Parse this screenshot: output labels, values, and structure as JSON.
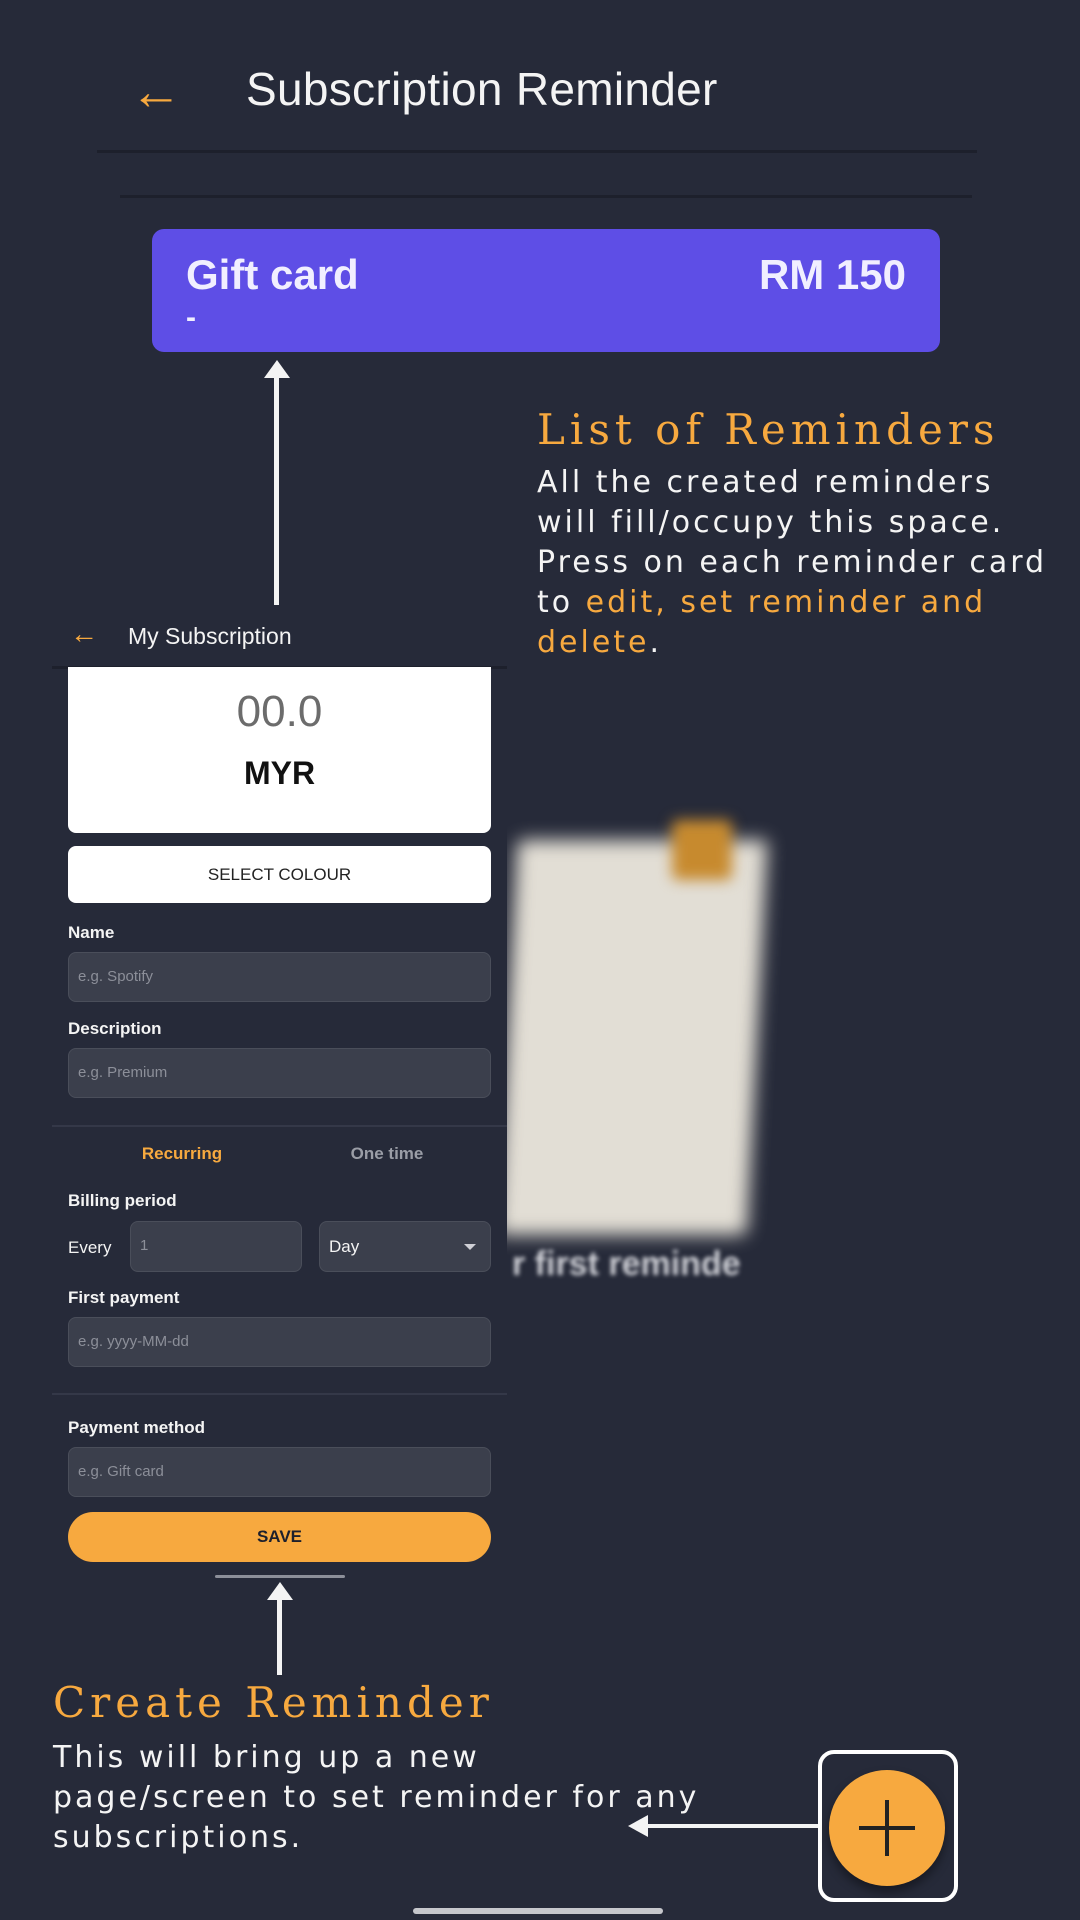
{
  "header": {
    "title": "Subscription Reminder",
    "back_icon": "arrow-back-icon"
  },
  "reminder_card": {
    "name": "Gift card",
    "description": "-",
    "amount": "RM 150",
    "color": "#5e4ee6"
  },
  "annotations": {
    "list": {
      "title": "List of Reminders",
      "body_lines": [
        "All the created reminders",
        "will fill/occupy this space.",
        "Press on each reminder card"
      ],
      "line4_prefix": "to ",
      "line4_highlight": "edit, set reminder and",
      "line5_highlight": "delete",
      "line5_suffix": "."
    },
    "create": {
      "title": "Create Reminder",
      "body_lines": [
        "This will bring up a new",
        "page/screen to set reminder for any",
        "subscriptions."
      ]
    }
  },
  "background_illustration": {
    "caption": "r first reminde"
  },
  "form": {
    "title": "My Subscription",
    "amount": "00.0",
    "currency": "MYR",
    "select_colour": "SELECT COLOUR",
    "name_label": "Name",
    "name_placeholder": "e.g. Spotify",
    "description_label": "Description",
    "description_placeholder": "e.g. Premium",
    "tab_recurring": "Recurring",
    "tab_onetime": "One time",
    "billing_period_label": "Billing period",
    "every_label": "Every",
    "every_placeholder": "1",
    "period_unit": "Day",
    "first_payment_label": "First payment",
    "first_payment_placeholder": "e.g. yyyy-MM-dd",
    "payment_method_label": "Payment method",
    "payment_method_placeholder": "e.g. Gift card",
    "save": "SAVE"
  },
  "fab": {
    "icon": "plus-icon"
  },
  "colors": {
    "accent": "#f7a93f",
    "background": "#262a39",
    "card": "#5e4ee6"
  }
}
